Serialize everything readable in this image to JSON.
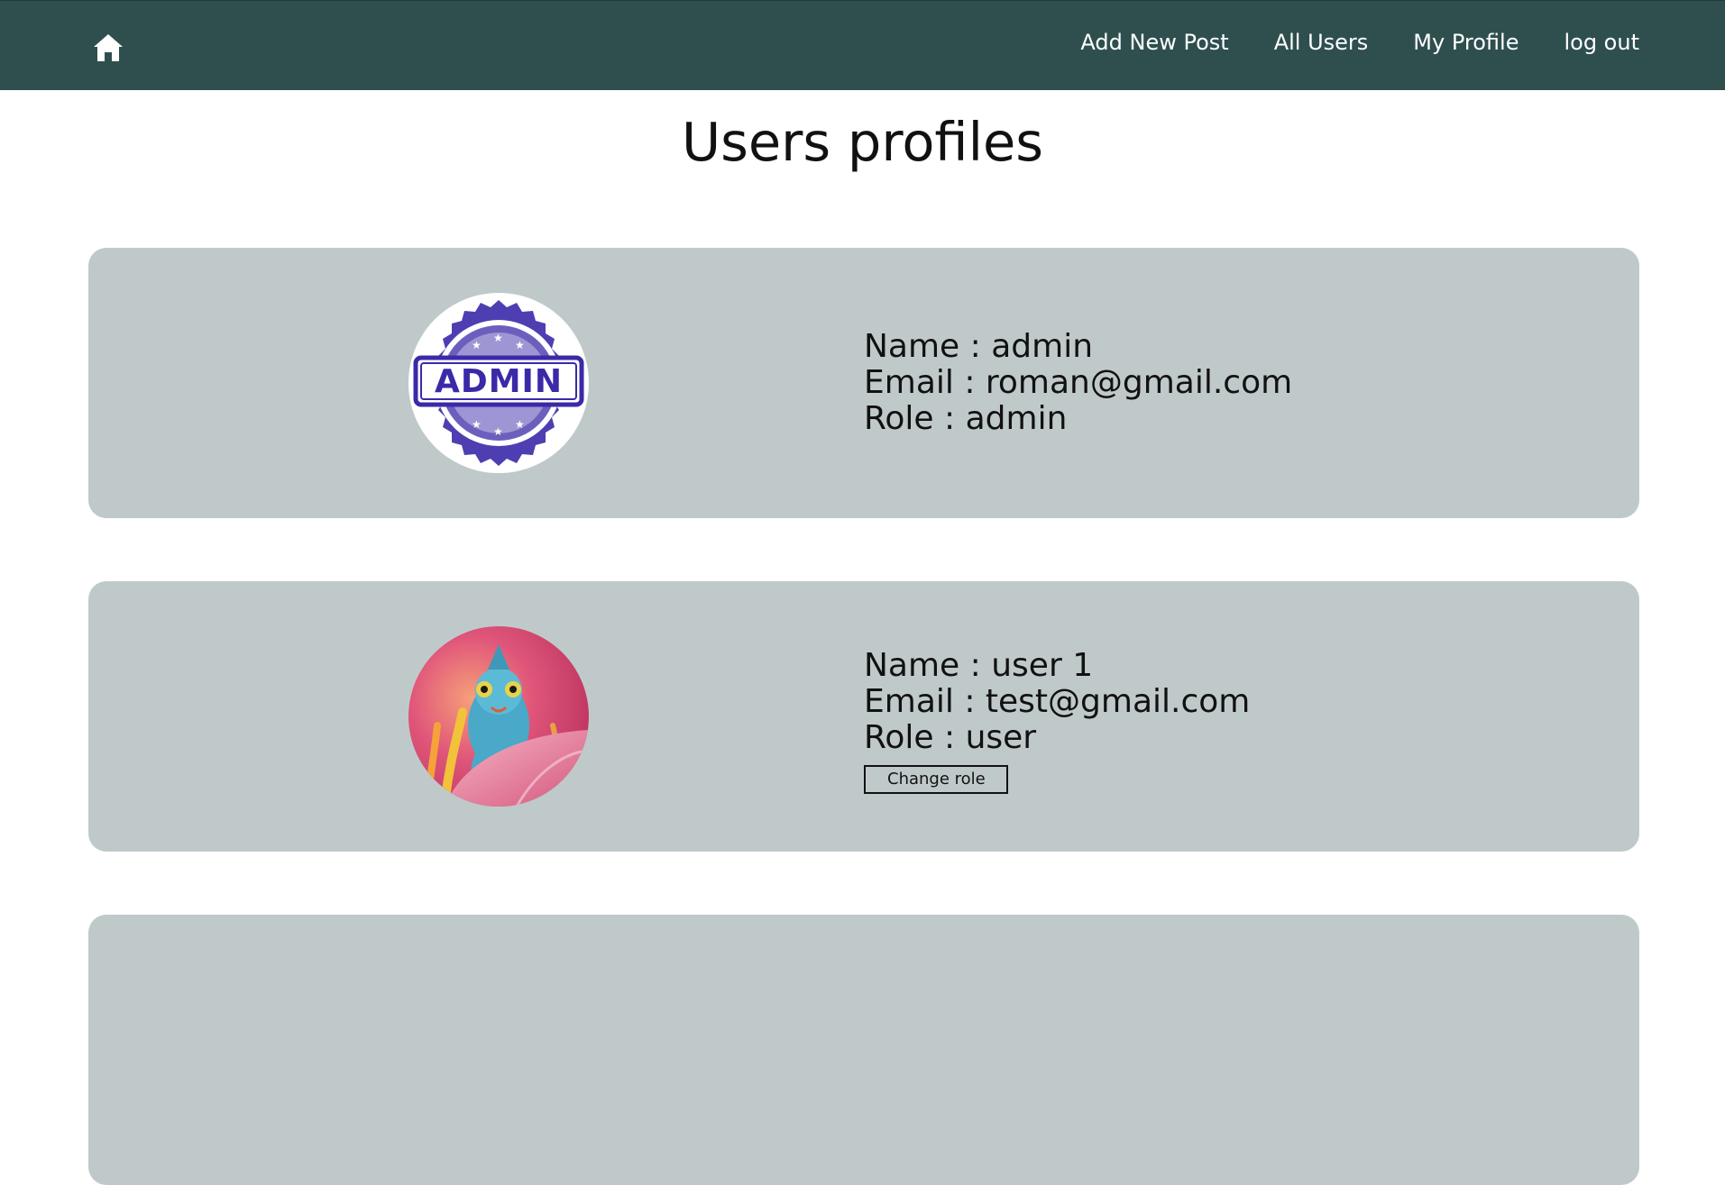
{
  "nav": {
    "home_icon": "home-icon",
    "links": [
      "Add New Post",
      "All Users",
      "My Profile",
      "log out"
    ]
  },
  "page": {
    "title": "Users profiles"
  },
  "users": [
    {
      "name_line": "Name : admin",
      "email_line": "Email : roman@gmail.com",
      "role_line": "Role : admin",
      "avatar": "admin-stamp-avatar",
      "avatar_stamp_text": "ADMIN"
    },
    {
      "name_line": "Name : user 1",
      "email_line": "Email : test@gmail.com",
      "role_line": "Role : user",
      "avatar": "chameleon-avatar",
      "change_role_label": "Change role"
    }
  ],
  "colors": {
    "navbar": "#2f4f4f",
    "card": "#c0c9ca",
    "nav_text": "#ffffff",
    "stamp": "#3a2aa8"
  }
}
